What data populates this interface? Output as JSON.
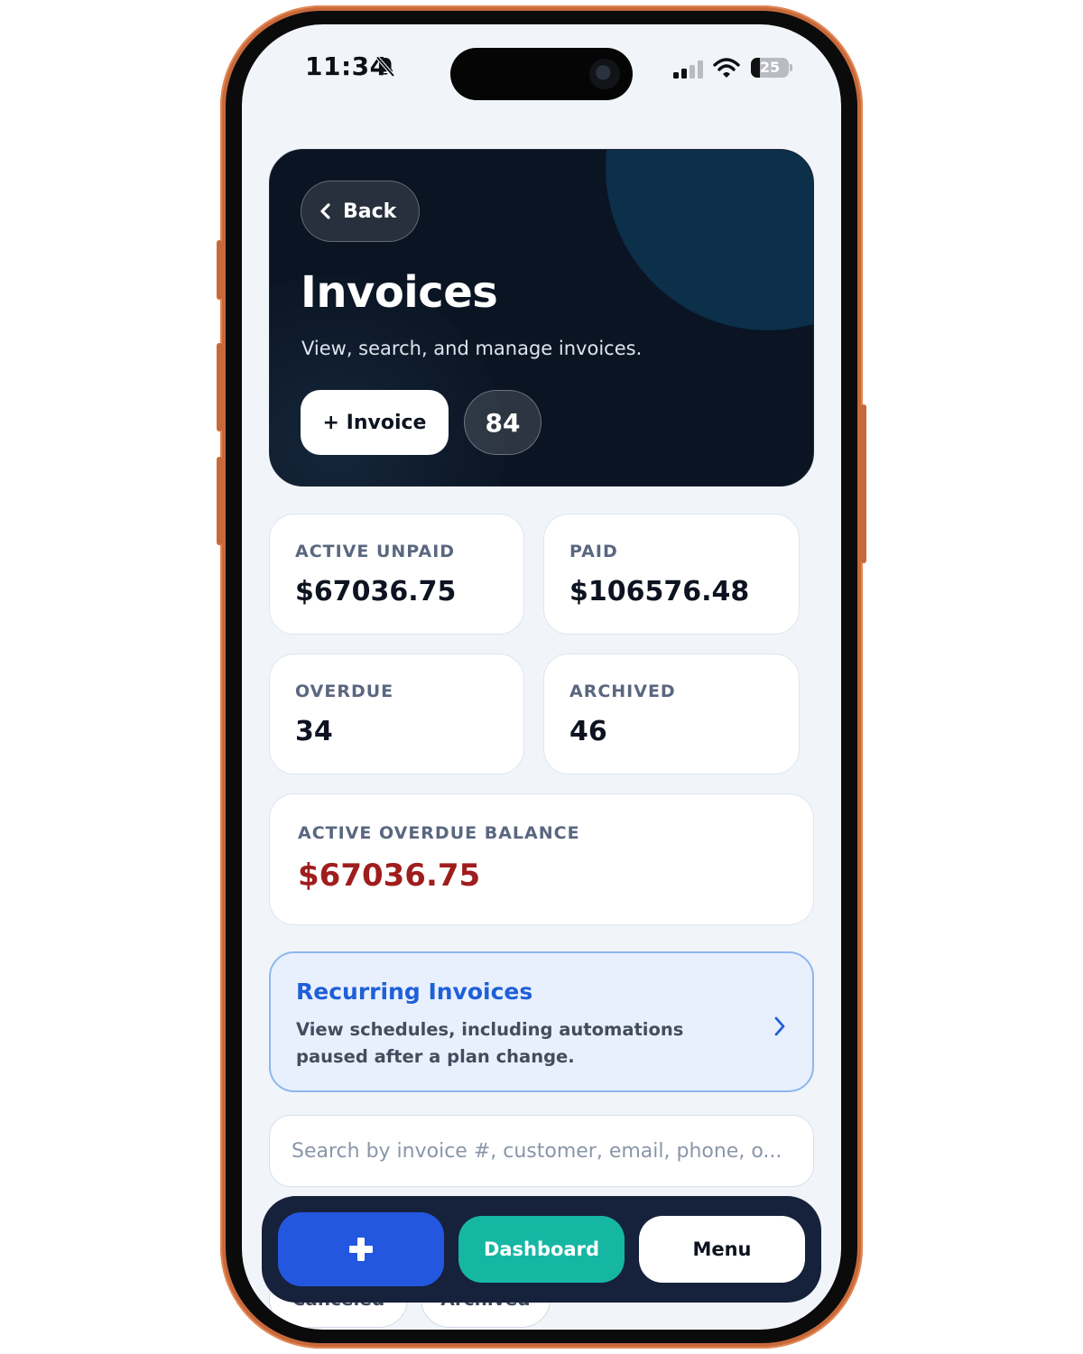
{
  "status_bar": {
    "time": "11:34",
    "battery": "25",
    "icons": [
      "bell-slash-icon",
      "signal-icon",
      "wifi-icon",
      "battery-icon"
    ]
  },
  "hero": {
    "back_label": "Back",
    "title": "Invoices",
    "subtitle": "View, search, and manage invoices.",
    "add_invoice_label": "+ Invoice",
    "count": "84"
  },
  "stats": {
    "active_unpaid": {
      "label": "ACTIVE UNPAID",
      "value": "$67036.75"
    },
    "paid": {
      "label": "PAID",
      "value": "$106576.48"
    },
    "overdue": {
      "label": "OVERDUE",
      "value": "34"
    },
    "archived": {
      "label": "ARCHIVED",
      "value": "46"
    },
    "active_overdue_balance": {
      "label": "ACTIVE OVERDUE BALANCE",
      "value": "$67036.75"
    }
  },
  "recurring": {
    "title": "Recurring Invoices",
    "description": "View schedules, including automations paused after a plan change."
  },
  "search": {
    "placeholder": "Search by invoice #, customer, email, phone, o..."
  },
  "filters": [
    "Canceled",
    "Archived"
  ],
  "bottom_nav": {
    "add_icon": "plus-icon",
    "dashboard_label": "Dashboard",
    "menu_label": "Menu"
  },
  "colors": {
    "hero_bg": "#0a1422",
    "accent_blue": "#2357e0",
    "teal": "#15b7a3",
    "overdue_red": "#a01d1d",
    "frame": "#c8693a"
  }
}
